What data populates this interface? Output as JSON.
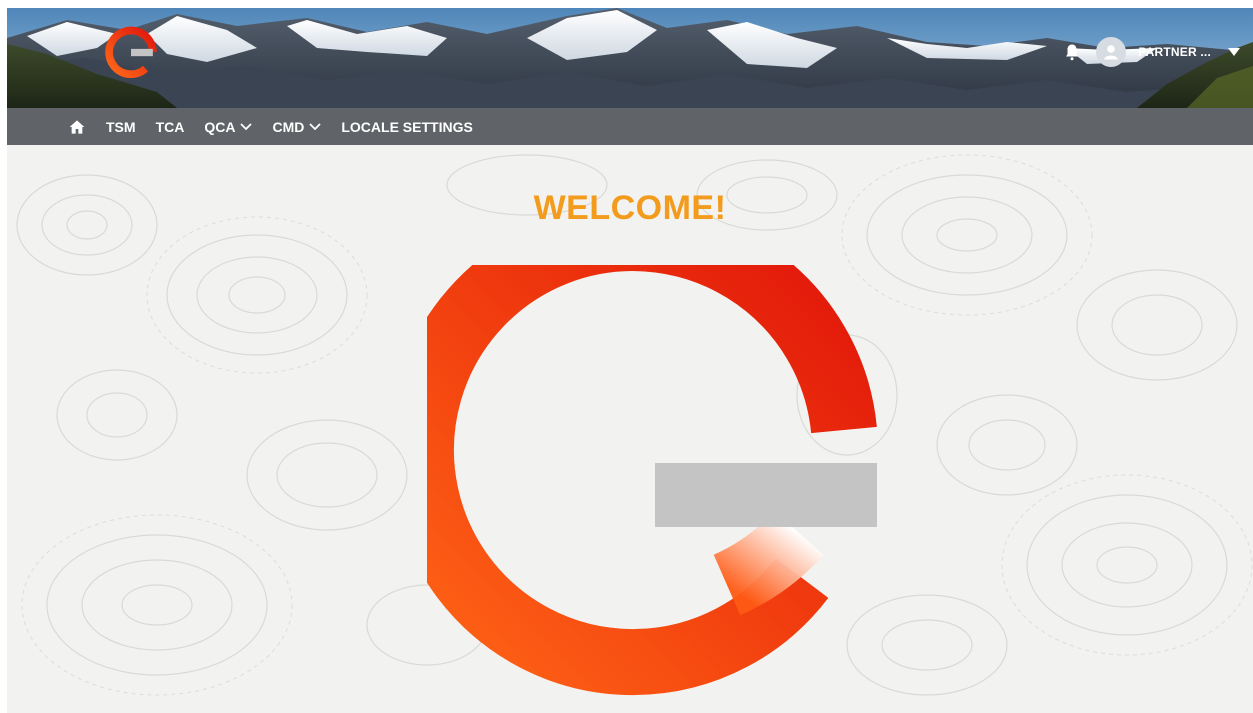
{
  "header": {
    "logo": "enel-e-logo",
    "notification_icon": "bell-icon",
    "user_label": "PARTNER ...",
    "avatar_icon": "user-icon",
    "menu_icon": "caret-down-icon"
  },
  "nav": {
    "home_icon": "home-icon",
    "items": [
      {
        "label": "TSM",
        "has_dropdown": false
      },
      {
        "label": "TCA",
        "has_dropdown": false
      },
      {
        "label": "QCA",
        "has_dropdown": true
      },
      {
        "label": "CMD",
        "has_dropdown": true
      },
      {
        "label": "LOCALE SETTINGS",
        "has_dropdown": false
      }
    ]
  },
  "main": {
    "welcome_text": "WELCOME!",
    "hero_logo": "enel-e-logo"
  },
  "colors": {
    "accent_orange": "#f39b1d",
    "logo_red": "#e8260f",
    "logo_orange": "#ff5a14",
    "logo_bar_gray": "#c4c4c4",
    "nav_bg": "#54585c",
    "page_bg": "#f2f2f1"
  }
}
